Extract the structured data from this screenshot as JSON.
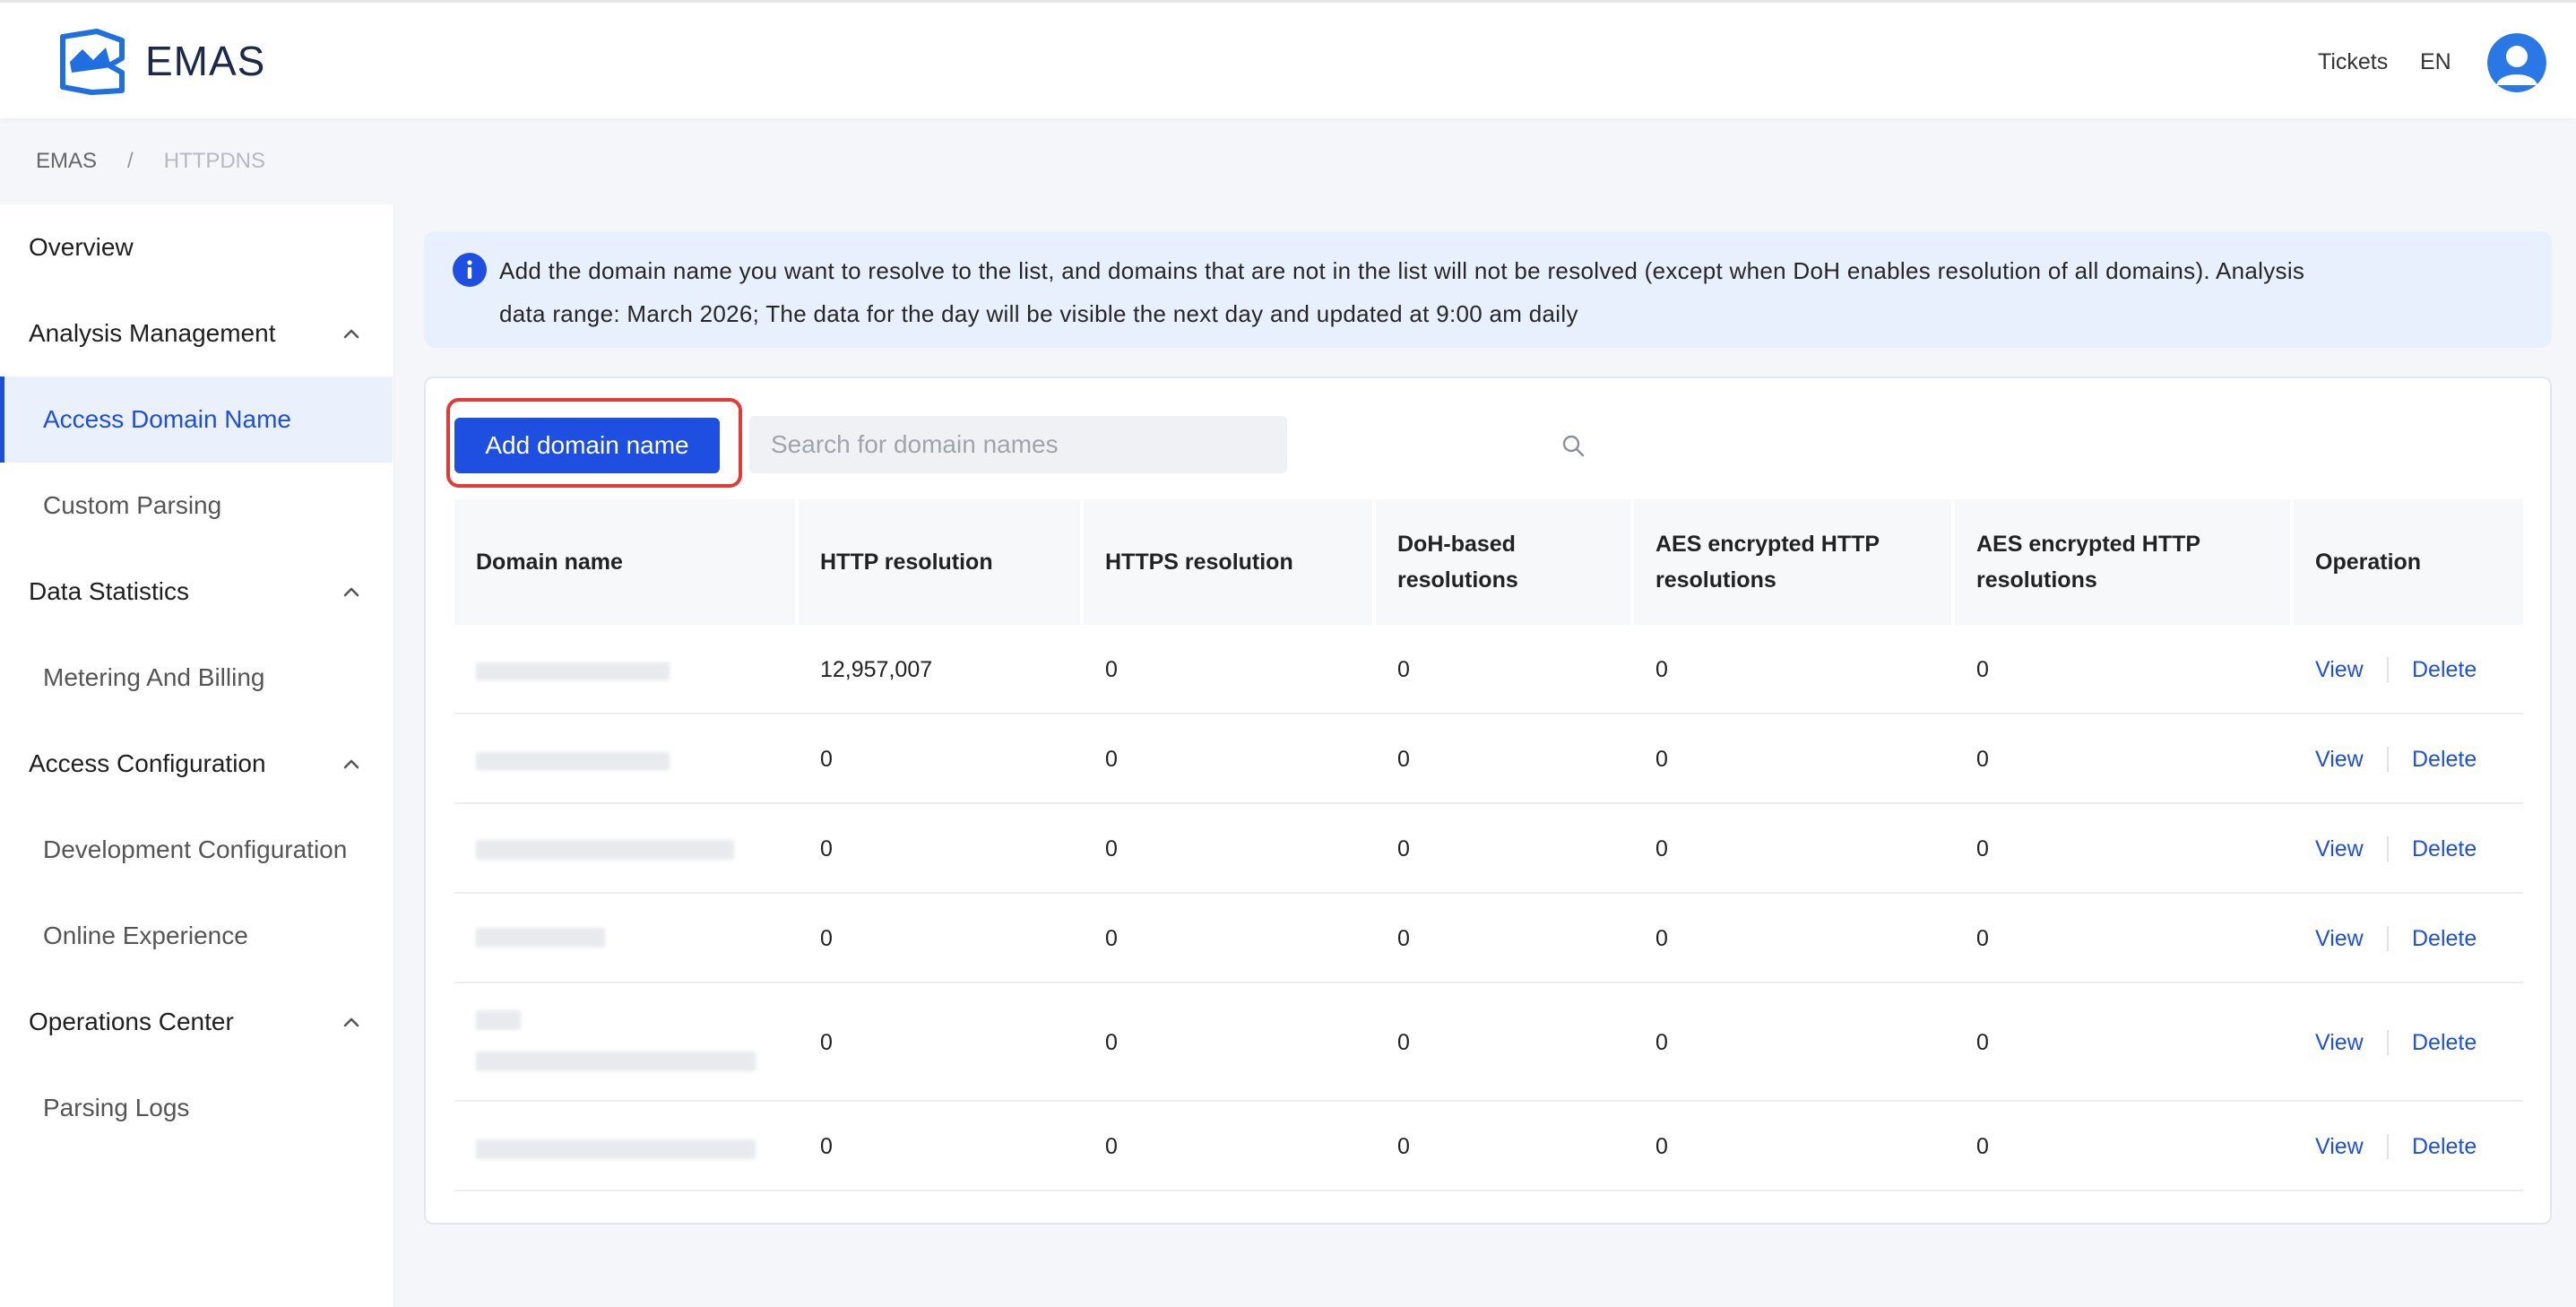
{
  "header": {
    "brand": "EMAS",
    "tickets_label": "Tickets",
    "language_label": "EN"
  },
  "breadcrumb": [
    "EMAS",
    "/",
    "HTTPDNS"
  ],
  "sidebar": {
    "items": [
      {
        "label": "Overview",
        "kind": "group"
      },
      {
        "label": "Analysis Management",
        "kind": "group",
        "expanded": true
      },
      {
        "label": "Access Domain Name",
        "kind": "sub",
        "active": true
      },
      {
        "label": "Custom Parsing",
        "kind": "sub"
      },
      {
        "label": "Data Statistics",
        "kind": "group",
        "expanded": true
      },
      {
        "label": "Metering And Billing",
        "kind": "sub"
      },
      {
        "label": "Access Configuration",
        "kind": "group",
        "expanded": true
      },
      {
        "label": "Development Configuration",
        "kind": "sub"
      },
      {
        "label": "Online Experience",
        "kind": "sub"
      },
      {
        "label": "Operations Center",
        "kind": "group",
        "expanded": true
      },
      {
        "label": "Parsing Logs",
        "kind": "sub"
      }
    ]
  },
  "notice": {
    "line1": "Add the domain name you want to resolve to the list, and domains that are not in the list will not be resolved (except when DoH enables resolution of all domains). Analysis",
    "line2": "data range: March 2026; The data for the day will be visible the next day and updated at 9:00 am daily"
  },
  "toolbar": {
    "add_label": "Add domain name",
    "search_placeholder": "Search for domain names"
  },
  "table": {
    "columns": [
      "Domain name",
      "HTTP resolution",
      "HTTPS resolution",
      "DoH-based resolutions",
      "AES encrypted HTTP resolutions",
      "AES encrypted HTTP resolutions",
      "Operation"
    ],
    "rows": [
      {
        "values": [
          "12,957,007",
          "0",
          "0",
          "0",
          "0"
        ],
        "view": "View",
        "delete": "Delete"
      },
      {
        "values": [
          "0",
          "0",
          "0",
          "0",
          "0"
        ],
        "view": "View",
        "delete": "Delete"
      },
      {
        "values": [
          "0",
          "0",
          "0",
          "0",
          "0"
        ],
        "view": "View",
        "delete": "Delete"
      },
      {
        "values": [
          "0",
          "0",
          "0",
          "0",
          "0"
        ],
        "view": "View",
        "delete": "Delete"
      },
      {
        "values": [
          "0",
          "0",
          "0",
          "0",
          "0"
        ],
        "view": "View",
        "delete": "Delete"
      },
      {
        "values": [
          "0",
          "0",
          "0",
          "0",
          "0"
        ],
        "view": "View",
        "delete": "Delete"
      }
    ]
  },
  "colors": {
    "accent": "#1e4fe0",
    "highlight": "#e53935",
    "notice_bg": "#e9f0fd"
  }
}
